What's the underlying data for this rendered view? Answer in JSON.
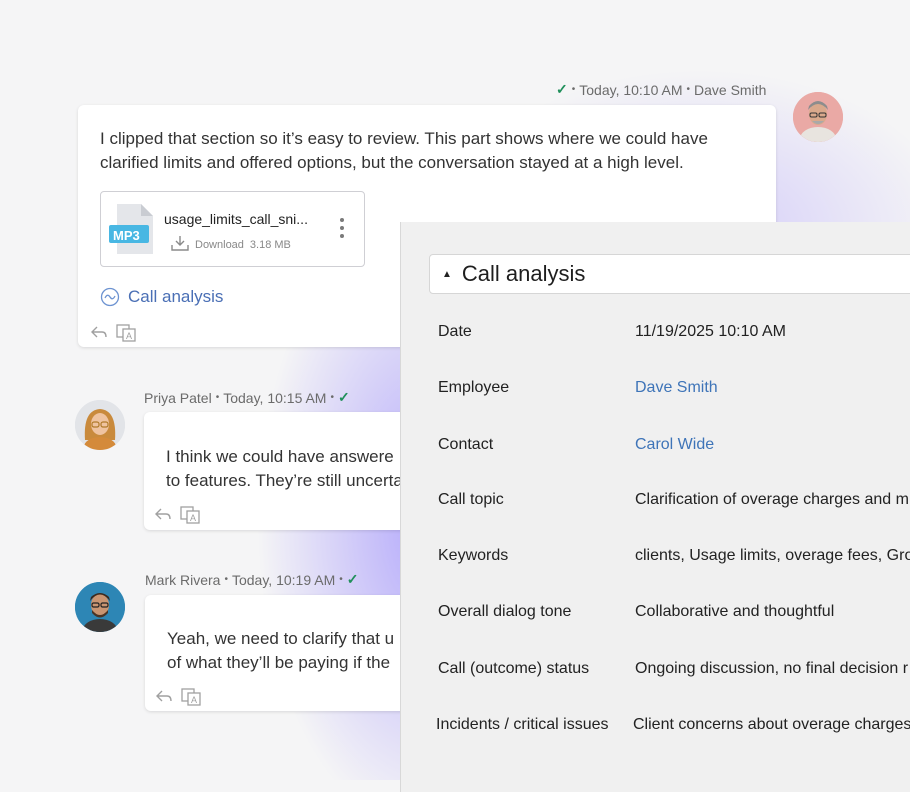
{
  "messages": [
    {
      "time": "Today, 10:10 AM",
      "author": "Dave Smith",
      "text": "I clipped that section so it’s easy to review. This part shows where we could have clarified limits and offered options, but the conversation stayed at a high level.",
      "attachment": {
        "badge": "MP3",
        "name": "usage_limits_call_sni...",
        "download_label": "Download",
        "size": "3.18 MB"
      },
      "analysis_link": "Call analysis"
    },
    {
      "author": "Priya Patel",
      "time": "Today, 10:15 AM",
      "text_line1": "I think we could have answere",
      "text_line2": "to features. They’re still uncerta"
    },
    {
      "author": "Mark Rivera",
      "time": "Today, 10:19 AM",
      "text_line1": "Yeah, we need to clarify that u",
      "text_line2": "of what they’ll be paying if the"
    }
  ],
  "panel": {
    "title": "Call analysis",
    "rows": [
      {
        "label": "Date",
        "value": "11/19/2025 10:10 AM"
      },
      {
        "label": "Employee",
        "value": "Dave Smith"
      },
      {
        "label": "Contact",
        "value": "Carol Wide"
      },
      {
        "label": "Call topic",
        "value": "Clarification of overage charges and m"
      },
      {
        "label": "Keywords",
        "value": "clients, Usage limits, overage fees, Gro"
      },
      {
        "label": "Overall dialog tone",
        "value": "Collaborative and thoughtful"
      },
      {
        "label": "Call (outcome) status",
        "value": "Ongoing discussion, no final decision r"
      },
      {
        "label": "Incidents / critical issues",
        "value": "Client concerns about overage charges"
      }
    ]
  },
  "colors": {
    "accent_link": "#3e74b8",
    "check_green": "#1f8f5a",
    "glow": "#7c68ff"
  }
}
